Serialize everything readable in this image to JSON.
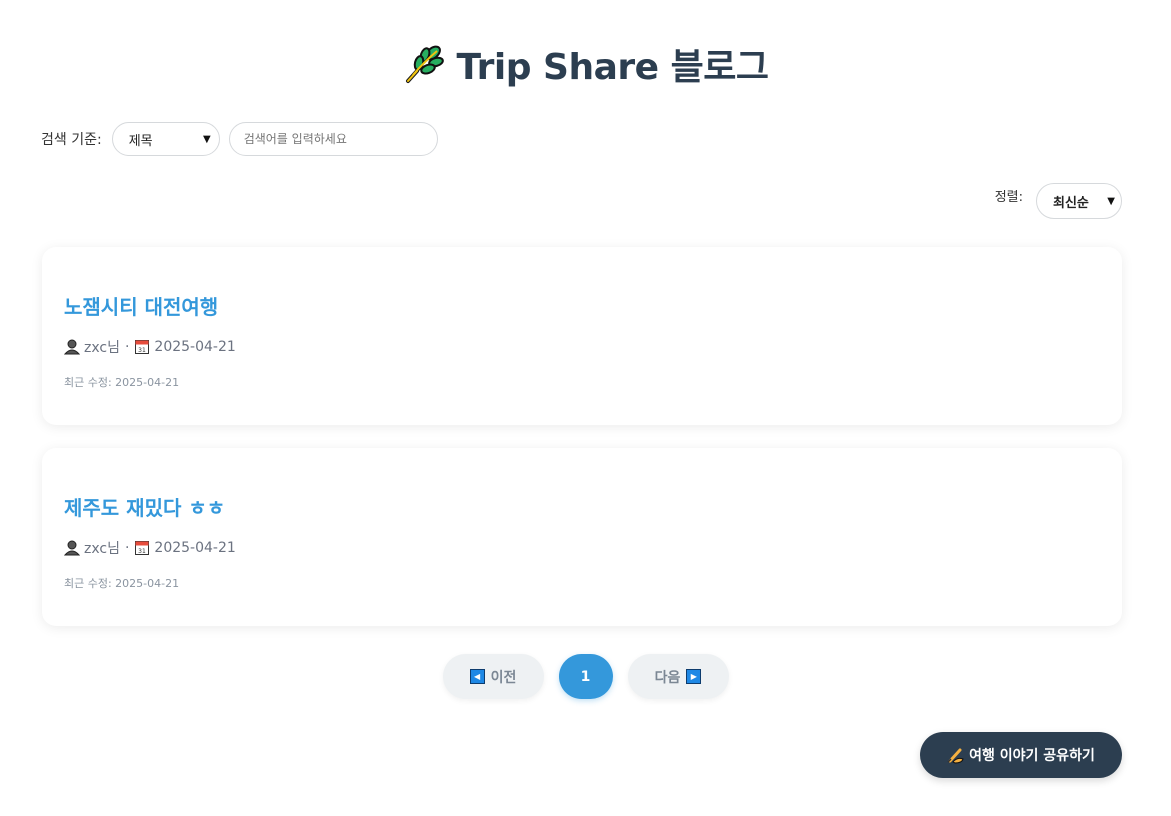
{
  "header": {
    "title": "Trip Share 블로그",
    "icon": "leaf-icon"
  },
  "search": {
    "label": "검색 기준:",
    "field_selected": "제목",
    "placeholder": "검색어를 입력하세요"
  },
  "sort": {
    "label": "정렬:",
    "selected": "최신순"
  },
  "posts": [
    {
      "title": "노잼시티 대전여행",
      "author": "zxc님",
      "separator": "·",
      "date": "2025-04-21",
      "updated": "최근 수정: 2025-04-21"
    },
    {
      "title": "제주도 재밌다 ㅎㅎ",
      "author": "zxc님",
      "separator": "·",
      "date": "2025-04-21",
      "updated": "최근 수정: 2025-04-21"
    }
  ],
  "pagination": {
    "prev_label": "이전",
    "current_page": "1",
    "next_label": "다음"
  },
  "share_button": {
    "label": "여행 이야기 공유하기"
  },
  "colors": {
    "accent": "#3498db",
    "dark": "#2c3e50",
    "pagination_bg": "#eef1f3"
  }
}
